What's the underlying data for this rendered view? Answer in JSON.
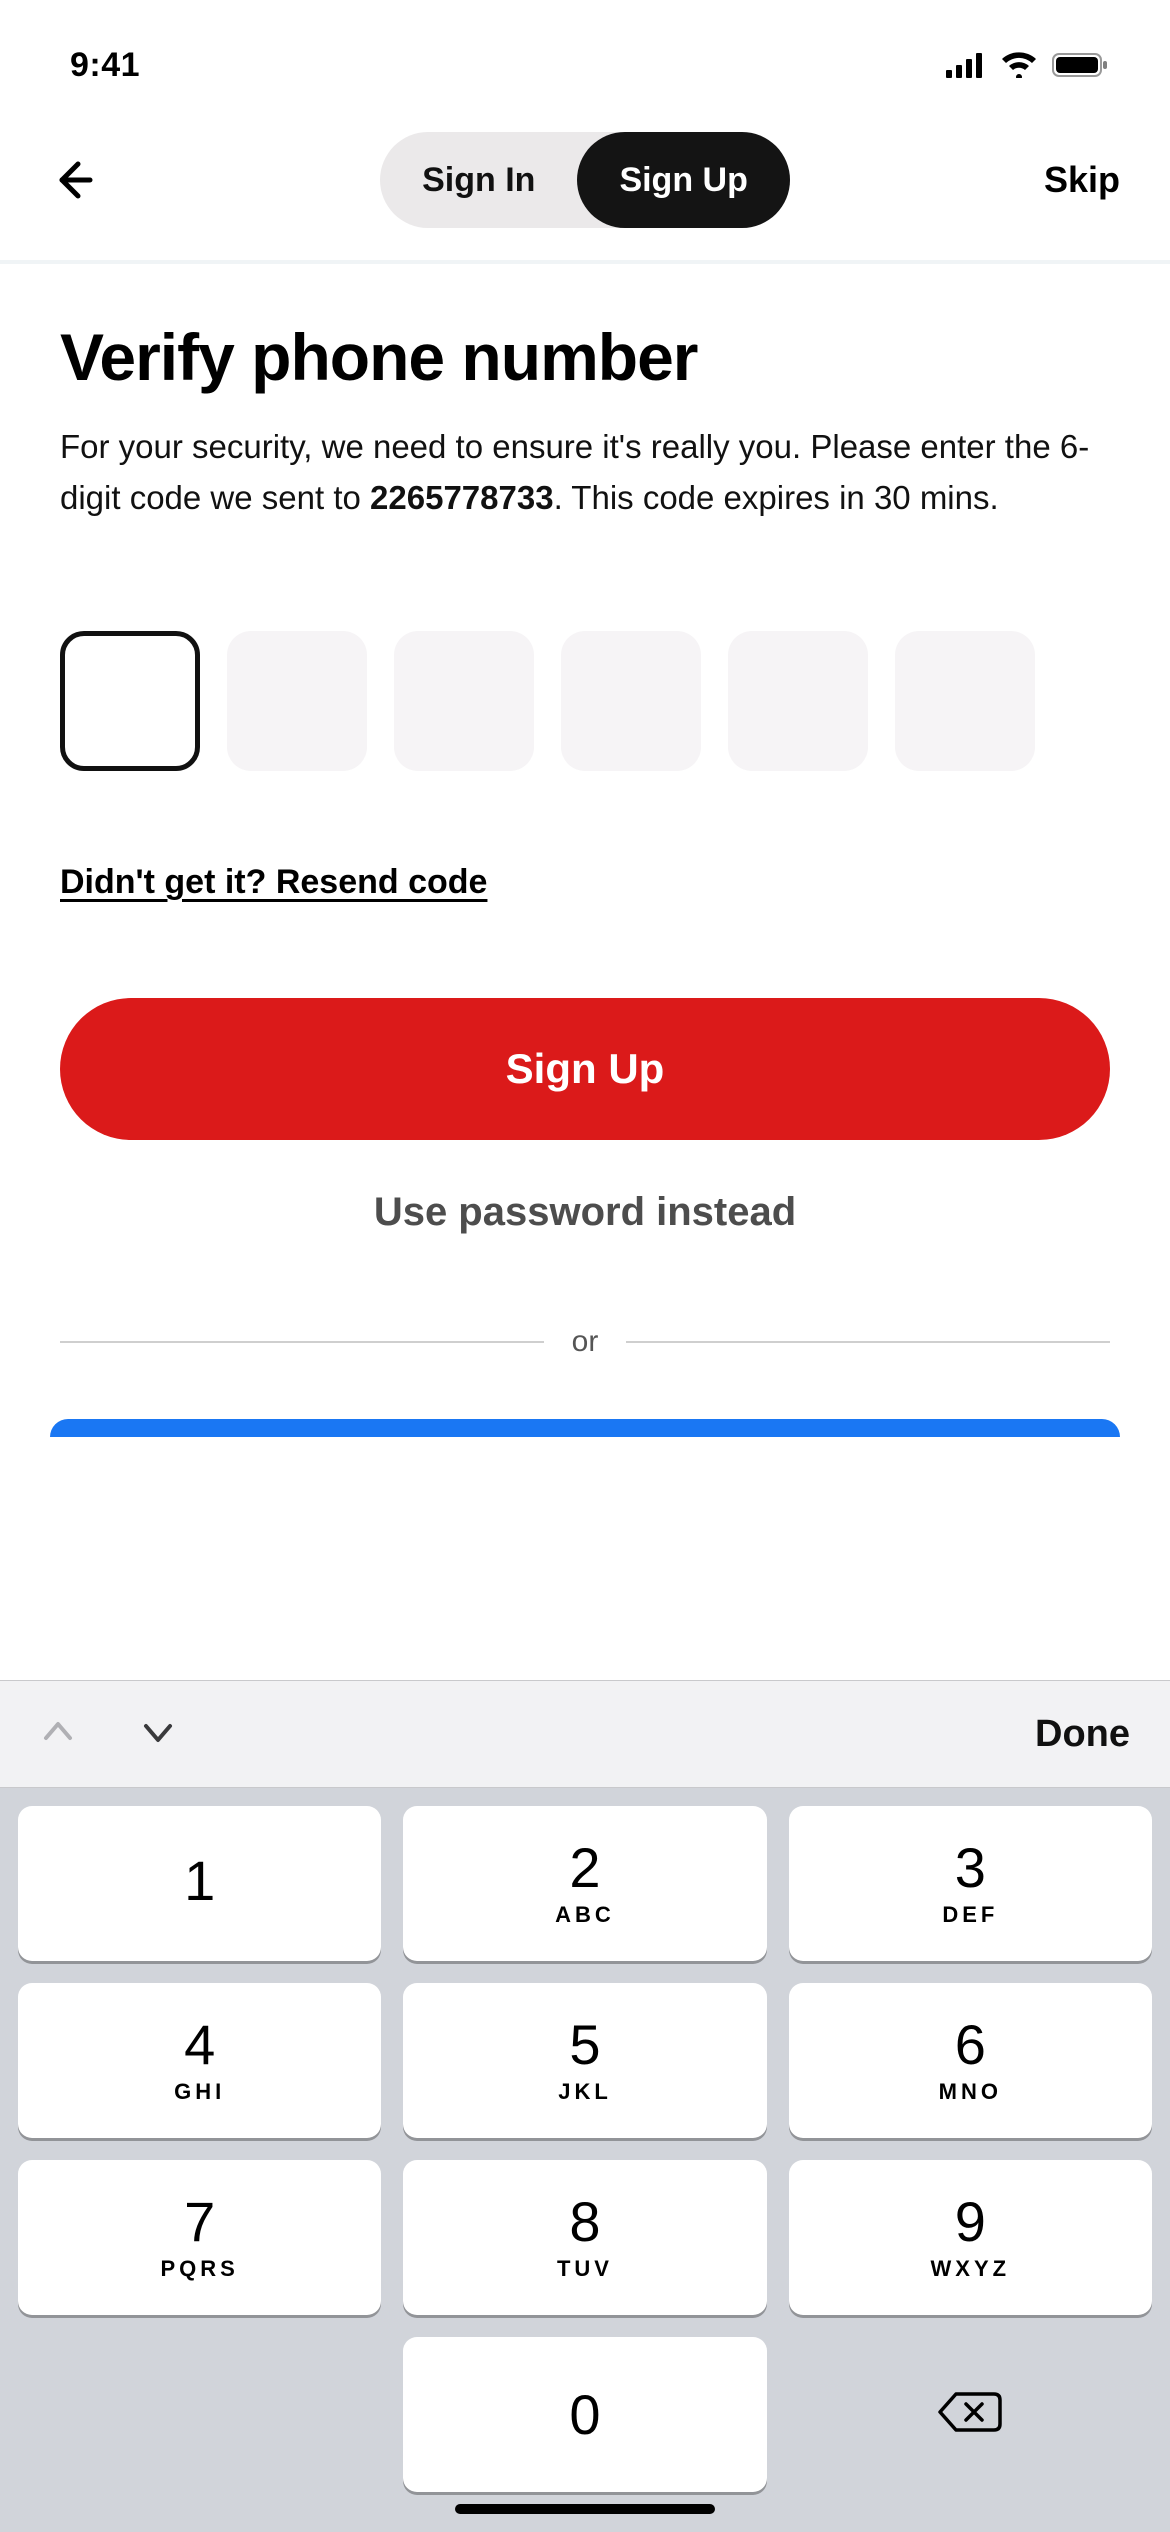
{
  "status": {
    "time": "9:41"
  },
  "nav": {
    "tabs": {
      "signin": "Sign In",
      "signup": "Sign Up",
      "active": "signup"
    },
    "skip": "Skip"
  },
  "page": {
    "title": "Verify phone number",
    "body_prefix": "For your security, we need to ensure it's really you. Please enter the 6-digit code we sent to ",
    "phone": "2265778733",
    "body_suffix": ". This code expires in 30 mins.",
    "resend": "Didn't get it? Resend code",
    "primary_button": "Sign Up",
    "alt_link": "Use password instead",
    "or": "or",
    "code_values": [
      "",
      "",
      "",
      "",
      "",
      ""
    ]
  },
  "keyboard": {
    "done": "Done",
    "keys": [
      {
        "n": "1",
        "sub": ""
      },
      {
        "n": "2",
        "sub": "ABC"
      },
      {
        "n": "3",
        "sub": "DEF"
      },
      {
        "n": "4",
        "sub": "GHI"
      },
      {
        "n": "5",
        "sub": "JKL"
      },
      {
        "n": "6",
        "sub": "MNO"
      },
      {
        "n": "7",
        "sub": "PQRS"
      },
      {
        "n": "8",
        "sub": "TUV"
      },
      {
        "n": "9",
        "sub": "WXYZ"
      }
    ],
    "zero": "0"
  }
}
